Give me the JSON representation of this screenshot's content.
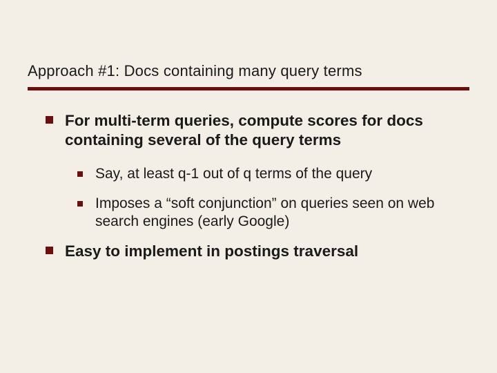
{
  "title": "Approach #1: Docs containing many query terms",
  "bullets": [
    {
      "text": "For multi-term queries, compute scores for docs containing several of the query terms",
      "children": [
        {
          "text": "Say, at least q-1 out of q terms of the query"
        },
        {
          "text": "Imposes a “soft conjunction” on queries seen on web search engines (early Google)"
        }
      ]
    },
    {
      "text": "Easy to implement in postings traversal"
    }
  ]
}
